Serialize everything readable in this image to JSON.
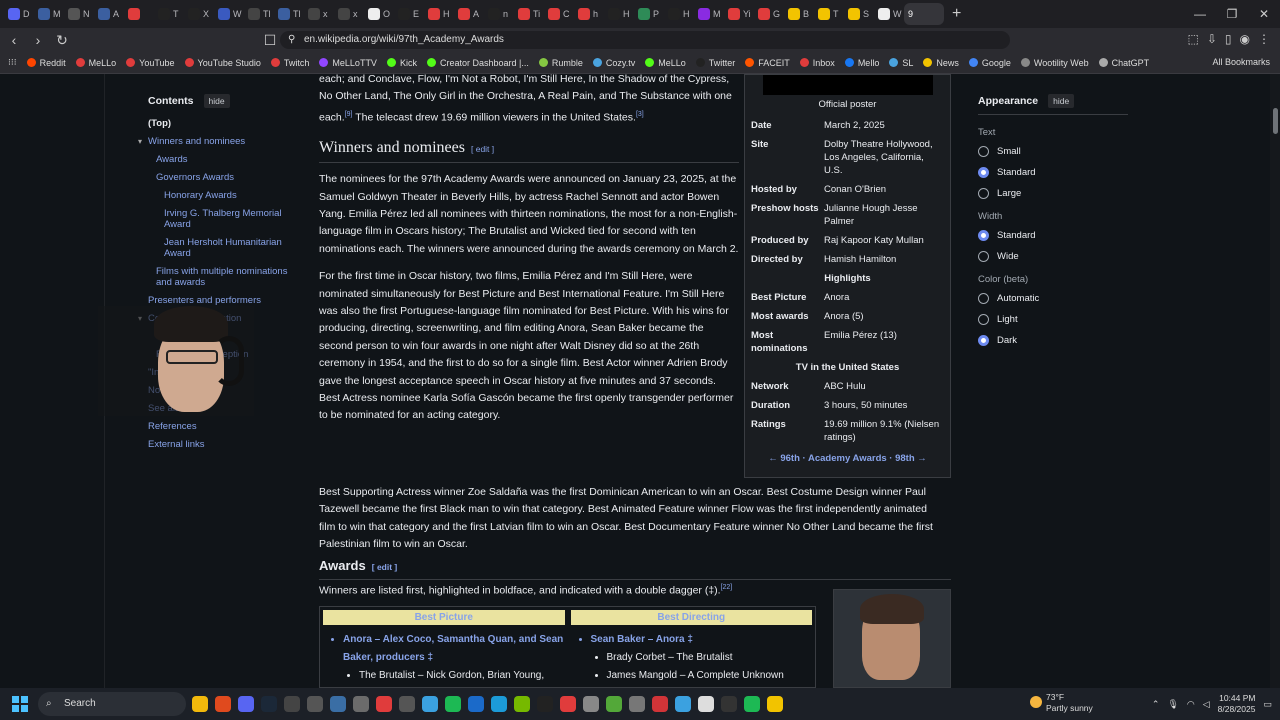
{
  "browser": {
    "tabs": [
      {
        "label": "D",
        "color": "#5865f2"
      },
      {
        "label": "M",
        "color": "#3b5fa0"
      },
      {
        "label": "N",
        "color": "#555"
      },
      {
        "label": "A",
        "color": "#3b5fa0"
      },
      {
        "label": "",
        "color": "#e03c3c"
      },
      {
        "label": "T",
        "color": "#222"
      },
      {
        "label": "X",
        "color": "#222"
      },
      {
        "label": "W",
        "color": "#3a5ac0"
      },
      {
        "label": "Tl",
        "color": "#444"
      },
      {
        "label": "Tl",
        "color": "#3b5fa0"
      },
      {
        "label": "x",
        "color": "#444"
      },
      {
        "label": "x",
        "color": "#444"
      },
      {
        "label": "O",
        "color": "#eee"
      },
      {
        "label": "E",
        "color": "#222"
      },
      {
        "label": "H",
        "color": "#e03c3c"
      },
      {
        "label": "A",
        "color": "#e03c3c"
      },
      {
        "label": "n",
        "color": "#222"
      },
      {
        "label": "Ti",
        "color": "#e03c3c"
      },
      {
        "label": "C",
        "color": "#e03c3c"
      },
      {
        "label": "h",
        "color": "#e03c3c"
      },
      {
        "label": "H",
        "color": "#222"
      },
      {
        "label": "P",
        "color": "#2e8b57"
      },
      {
        "label": "H",
        "color": "#222"
      },
      {
        "label": "M",
        "color": "#8a2be2"
      },
      {
        "label": "Yi",
        "color": "#e03c3c"
      },
      {
        "label": "G",
        "color": "#e03c3c"
      },
      {
        "label": "B",
        "color": "#f2c300"
      },
      {
        "label": "T",
        "color": "#f2c300"
      },
      {
        "label": "S",
        "color": "#f2c300"
      },
      {
        "label": "W",
        "color": "#eee"
      }
    ],
    "active_tab": "9",
    "url": "en.wikipedia.org/wiki/97th_Academy_Awards",
    "bookmarks": [
      {
        "label": "Reddit",
        "color": "#ff4500"
      },
      {
        "label": "MeLLo",
        "color": "#e03c3c"
      },
      {
        "label": "YouTube",
        "color": "#e03c3c"
      },
      {
        "label": "YouTube Studio",
        "color": "#e03c3c"
      },
      {
        "label": "Twitch",
        "color": "#e03c3c"
      },
      {
        "label": "MeLLoTTV",
        "color": "#9146ff"
      },
      {
        "label": "Kick",
        "color": "#53fc18"
      },
      {
        "label": "Creator Dashboard |...",
        "color": "#53fc18"
      },
      {
        "label": "Rumble",
        "color": "#85c742"
      },
      {
        "label": "Cozy.tv",
        "color": "#4aa3df"
      },
      {
        "label": "MeLLo",
        "color": "#53fc18"
      },
      {
        "label": "Twitter",
        "color": "#222"
      },
      {
        "label": "FACEIT",
        "color": "#ff5500"
      },
      {
        "label": "Inbox",
        "color": "#e03c3c"
      },
      {
        "label": "Mello",
        "color": "#1877f2"
      },
      {
        "label": "SL",
        "color": "#4aa3df"
      },
      {
        "label": "News",
        "color": "#f2c300"
      },
      {
        "label": "Google",
        "color": "#4285f4"
      },
      {
        "label": "Wootility Web",
        "color": "#888"
      },
      {
        "label": "ChatGPT",
        "color": "#aaa"
      }
    ],
    "all_bookmarks": "All Bookmarks"
  },
  "toc": {
    "title": "Contents",
    "hide": "hide",
    "items": [
      {
        "label": "(Top)",
        "level": 1
      },
      {
        "label": "Winners and nominees",
        "level": 1
      },
      {
        "label": "Awards",
        "level": 2
      },
      {
        "label": "Governors Awards",
        "level": 2
      },
      {
        "label": "Honorary Awards",
        "level": 3
      },
      {
        "label": "Irving G. Thalberg Memorial Award",
        "level": 3
      },
      {
        "label": "Jean Hersholt Humanitarian Award",
        "level": 3
      },
      {
        "label": "Films with multiple nominations and awards",
        "level": 2
      },
      {
        "label": "Presenters and performers",
        "level": 1
      },
      {
        "label": "Ceremony information",
        "level": 1
      },
      {
        "label": "Critical reviews",
        "level": 2
      },
      {
        "label": "Ratings and reception",
        "level": 2
      },
      {
        "label": "\"In Memoriam\"",
        "level": 1
      },
      {
        "label": "Notes",
        "level": 1
      },
      {
        "label": "See also",
        "level": 1
      },
      {
        "label": "References",
        "level": 1
      },
      {
        "label": "External links",
        "level": 1
      }
    ]
  },
  "article": {
    "intro_tail": "each; and Conclave, Flow, I'm Not a Robot, I'm Still Here, In the Shadow of the Cypress, No Other Land, The Only Girl in the Orchestra, A Real Pain, and The Substance with one each.",
    "intro_tail2": " The telecast drew 19.69 million viewers in the United States.",
    "sec_title": "Winners and nominees",
    "edit": "edit",
    "p1": "The nominees for the 97th Academy Awards were announced on January 23, 2025, at the Samuel Goldwyn Theater in Beverly Hills, by actress Rachel Sennott and actor Bowen Yang. Emilia Pérez led all nominees with thirteen nominations, the most for a non-English-language film in Oscars history; The Brutalist and Wicked tied for second with ten nominations each. The winners were announced during the awards ceremony on March 2.",
    "p2": "For the first time in Oscar history, two films, Emilia Pérez and I'm Still Here, were nominated simultaneously for Best Picture and Best International Feature. I'm Still Here was also the first Portuguese-language film nominated for Best Picture. With his wins for producing, directing, screenwriting, and film editing Anora, Sean Baker became the second person to win four awards in one night after Walt Disney did so at the 26th ceremony in 1954, and the first to do so for a single film. Best Actor winner Adrien Brody gave the longest acceptance speech in Oscar history at five minutes and 37 seconds. Best Actress nominee Karla Sofía Gascón became the first openly transgender performer to be nominated for an acting category.",
    "p3": "Best Supporting Actress winner Zoe Saldaña was the first Dominican American to win an Oscar. Best Costume Design winner Paul Tazewell became the first Black man to win that category. Best Animated Feature winner Flow was the first independently animated film to win that category and the first Latvian film to win an Oscar. Best Documentary Feature winner No Other Land became the first Palestinian film to win an Oscar.",
    "awards_title": "Awards",
    "awards_intro": "Winners are listed first, highlighted in boldface, and indicated with a double dagger (‡).",
    "best_picture_head": "Best Picture",
    "best_picture_winner": "Anora – Alex Coco, Samantha Quan, and Sean Baker, producers ‡",
    "best_picture_nominee": "The Brutalist – Nick Gordon, Brian Young,",
    "best_directing_head": "Best Directing",
    "best_directing_winner": "Sean Baker – Anora ‡",
    "best_directing_nominee1": "Brady Corbet – The Brutalist",
    "best_directing_nominee2": "James Mangold – A Complete Unknown"
  },
  "infobox": {
    "caption": "Official poster",
    "rows": [
      {
        "k": "Date",
        "v": "March 2, 2025"
      },
      {
        "k": "Site",
        "v": "Dolby Theatre Hollywood, Los Angeles, California, U.S."
      },
      {
        "k": "Hosted by",
        "v": "Conan O'Brien"
      },
      {
        "k": "Preshow hosts",
        "v": "Julianne Hough Jesse Palmer"
      },
      {
        "k": "Produced by",
        "v": "Raj Kapoor Katy Mullan"
      },
      {
        "k": "Directed by",
        "v": "Hamish Hamilton"
      }
    ],
    "highlights": "Highlights",
    "hrows": [
      {
        "k": "Best Picture",
        "v": "Anora"
      },
      {
        "k": "Most awards",
        "v": "Anora (5)"
      },
      {
        "k": "Most nominations",
        "v": "Emilia Pérez (13)"
      }
    ],
    "tv": "TV in the United States",
    "tvrows": [
      {
        "k": "Network",
        "v": "ABC Hulu"
      },
      {
        "k": "Duration",
        "v": "3 hours, 50 minutes"
      },
      {
        "k": "Ratings",
        "v": "19.69 million 9.1% (Nielsen ratings)"
      }
    ],
    "nav": "← 96th · Academy Awards · 98th →"
  },
  "appearance": {
    "title": "Appearance",
    "hide": "hide",
    "text_label": "Text",
    "text_opts": [
      "Small",
      "Standard",
      "Large"
    ],
    "text_selected": 1,
    "width_label": "Width",
    "width_opts": [
      "Standard",
      "Wide"
    ],
    "width_selected": 0,
    "color_label": "Color (beta)",
    "color_opts": [
      "Automatic",
      "Light",
      "Dark"
    ],
    "color_selected": 2
  },
  "taskbar": {
    "search": "Search",
    "weather_temp": "73°F",
    "weather_desc": "Partly sunny",
    "time": "10:44 PM",
    "date": "8/28/2025"
  }
}
